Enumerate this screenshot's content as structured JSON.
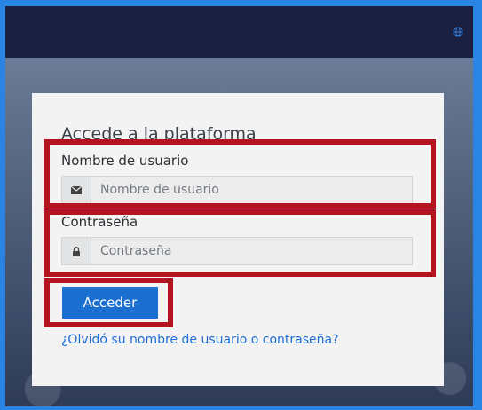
{
  "header": {
    "language_icon": "globe-icon"
  },
  "login": {
    "title": "Accede a la plataforma",
    "username": {
      "label": "Nombre de usuario",
      "placeholder": "Nombre de usuario",
      "icon": "envelope-icon"
    },
    "password": {
      "label": "Contraseña",
      "placeholder": "Contraseña",
      "icon": "lock-icon"
    },
    "submit_label": "Acceder",
    "forgot_link": "¿Olvidó su nombre de usuario o contraseña?"
  },
  "colors": {
    "navbar": "#1b1f42",
    "primary_button": "#1a6fd1",
    "link": "#1f6ed4",
    "highlight": "#b3141f",
    "outer_border": "#2a84e3"
  }
}
